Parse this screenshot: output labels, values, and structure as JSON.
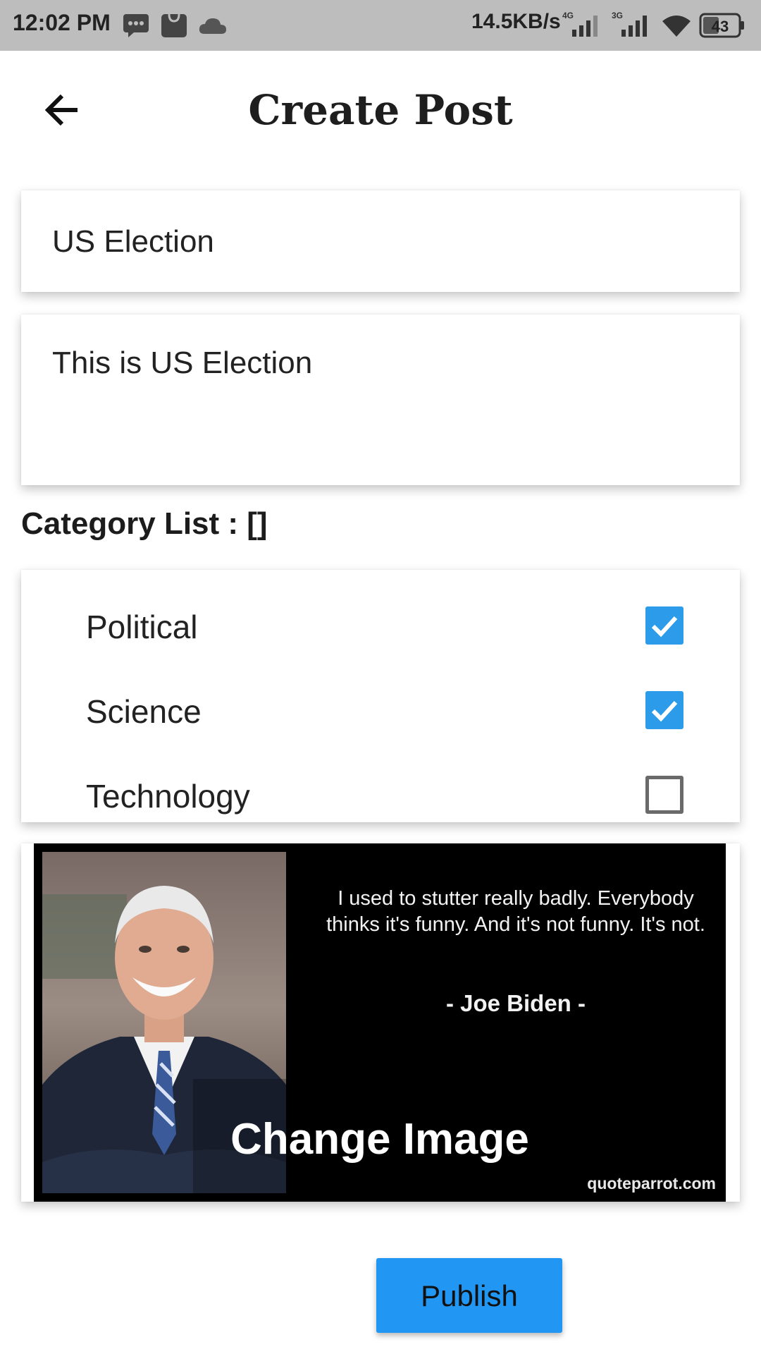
{
  "status_bar": {
    "time": "12:02 PM",
    "network_speed": "14.5KB/s",
    "net1": "4G",
    "net2": "3G",
    "battery": "43",
    "icons": [
      "message-icon",
      "mi-store-icon",
      "cloud-icon",
      "signal-icon",
      "wifi-icon",
      "battery-icon"
    ]
  },
  "header": {
    "title": "Create Post",
    "back_icon": "arrow-back-icon"
  },
  "form": {
    "title_value": "US Election",
    "body_value": "This is US Election"
  },
  "categories": {
    "heading": "Category List : []",
    "items": [
      {
        "label": "Political",
        "checked": true
      },
      {
        "label": "Science",
        "checked": true
      },
      {
        "label": "Technology",
        "checked": false
      }
    ]
  },
  "image": {
    "quote": "I used to stutter really badly. Everybody thinks it's funny. And it's not funny. It's not.",
    "author": "- Joe Biden -",
    "watermark": "quoteparrot.com",
    "change_label": "Change Image"
  },
  "actions": {
    "publish_label": "Publish"
  },
  "colors": {
    "accent": "#2196f3",
    "checkbox": "#2b9bea",
    "status_bar": "#bdbdbd"
  }
}
